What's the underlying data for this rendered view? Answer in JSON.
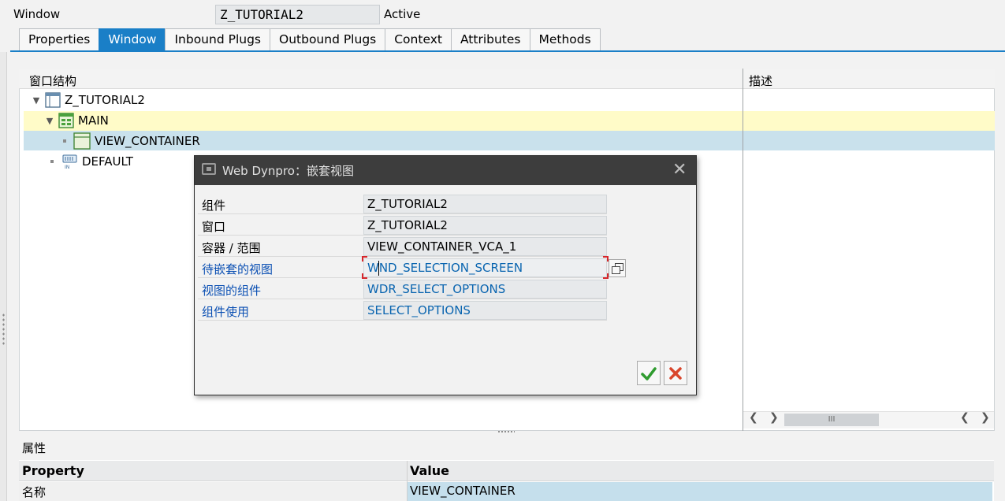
{
  "header": {
    "object_type_label": "Window",
    "object_name": "Z_TUTORIAL2",
    "status": "Active"
  },
  "tabs": [
    {
      "label": "Properties",
      "active": false
    },
    {
      "label": "Window",
      "active": true
    },
    {
      "label": "Inbound Plugs",
      "active": false
    },
    {
      "label": "Outbound Plugs",
      "active": false
    },
    {
      "label": "Context",
      "active": false
    },
    {
      "label": "Attributes",
      "active": false
    },
    {
      "label": "Methods",
      "active": false
    }
  ],
  "tree": {
    "column_structure": "窗口结构",
    "column_description": "描述",
    "nodes": [
      {
        "label": "Z_TUTORIAL2",
        "icon": "window-icon",
        "expanded": true
      },
      {
        "label": "MAIN",
        "icon": "view-icon",
        "expanded": true,
        "highlight": "#fffbc8"
      },
      {
        "label": "VIEW_CONTAINER",
        "icon": "container-icon",
        "selected": true,
        "highlight": "#c9e1ec"
      },
      {
        "label": "DEFAULT",
        "icon": "inbound-plug-icon"
      }
    ],
    "scroll_thumb": "III"
  },
  "properties": {
    "title": "属性",
    "col_property": "Property",
    "col_value": "Value",
    "rows": [
      {
        "property": "名称",
        "value": "VIEW_CONTAINER"
      }
    ]
  },
  "dialog": {
    "title": "Web Dynpro：嵌套视图",
    "fields": [
      {
        "label": "组件",
        "value": "Z_TUTORIAL2",
        "editable": false
      },
      {
        "label": "窗口",
        "value": "Z_TUTORIAL2",
        "editable": false
      },
      {
        "label": "容器 / 范围",
        "value": "VIEW_CONTAINER_VCA_1",
        "editable": false
      },
      {
        "label": "待嵌套的视图",
        "value": "WND_SELECTION_SCREEN",
        "editable": true
      },
      {
        "label": "视图的组件",
        "value": "WDR_SELECT_OPTIONS",
        "editable": true
      },
      {
        "label": "组件使用",
        "value": "SELECT_OPTIONS",
        "editable": true
      }
    ],
    "confirm_icon": "check-icon",
    "cancel_icon": "cancel-x-icon"
  },
  "colors": {
    "accent": "#1a7fc7",
    "link_blue": "#0a4fb3",
    "highlight_yellow": "#fffbc8",
    "selection_blue": "#c9e1ec",
    "dialog_title_bg": "#3d3d3d"
  }
}
